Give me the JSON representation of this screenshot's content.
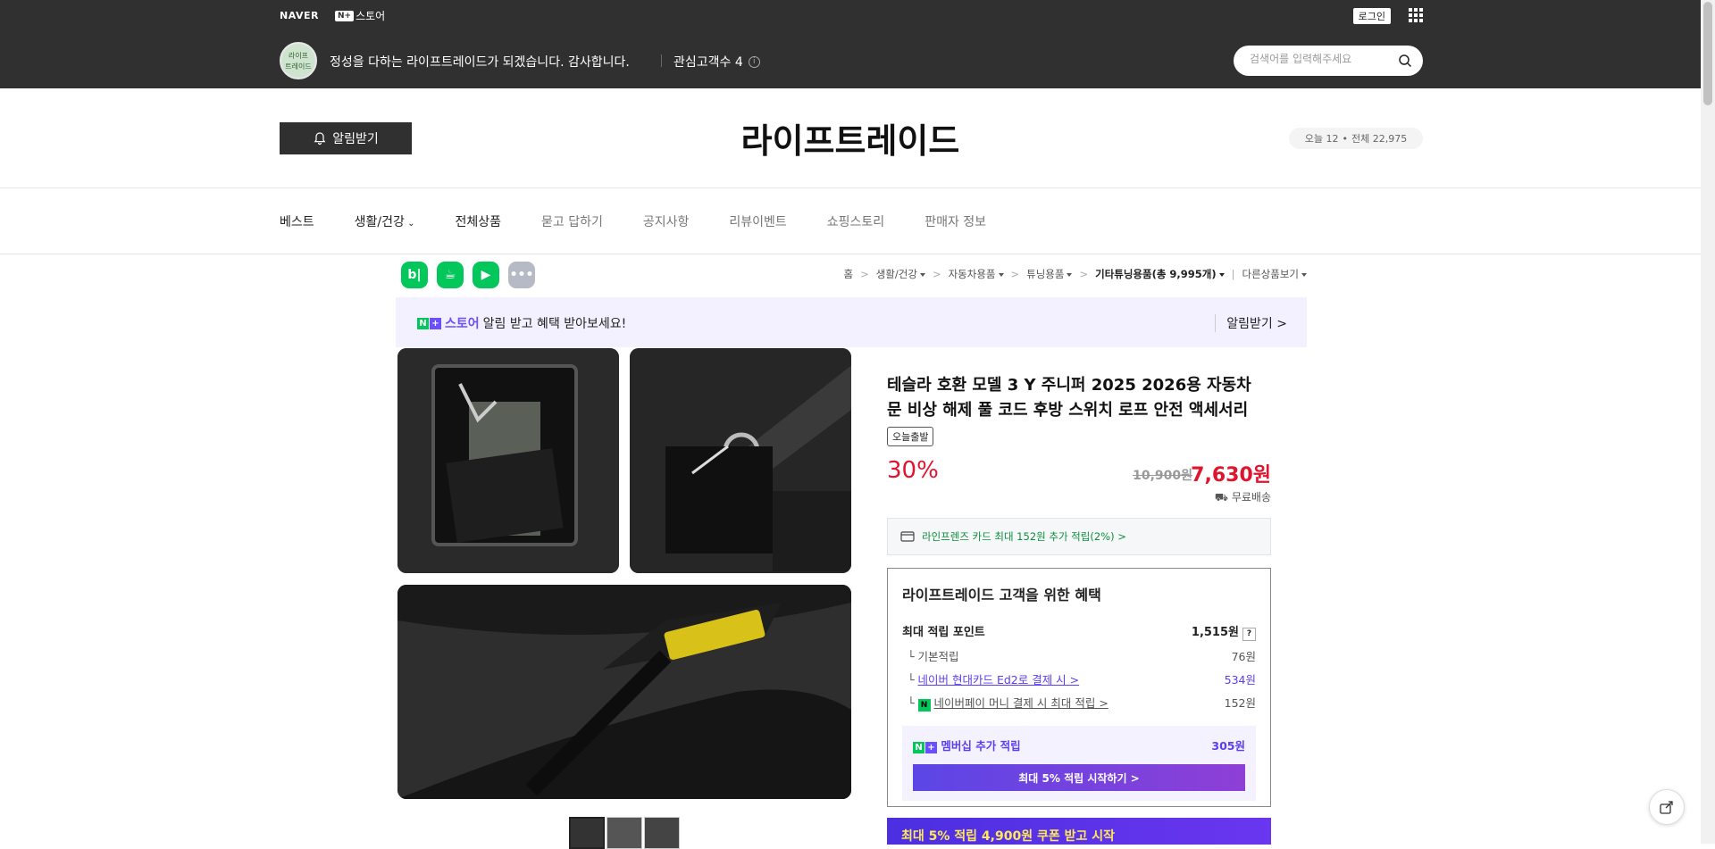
{
  "gnb": {
    "naver": "NAVER",
    "nplus": "N+",
    "store_suffix": "스토어",
    "login": "로그인"
  },
  "store": {
    "logo_text": "라이프\n트레이드",
    "description": "정성을 다하는 라이프트레이드가 되겠습니다. 감사합니다.",
    "fans_label": "관심고객수 4",
    "search_placeholder": "검색어를 입력해주세요"
  },
  "header": {
    "alarm_button": "알림받기",
    "title": "라이프트레이드",
    "visit_today": "오늘 12",
    "visit_dot": "•",
    "visit_total": "전체 22,975"
  },
  "nav": {
    "items": [
      "베스트",
      "생활/건강",
      "전체상품",
      "묻고 답하기",
      "공지사항",
      "리뷰이벤트",
      "쇼핑스토리",
      "판매자 정보"
    ]
  },
  "share": {
    "blog": "b|",
    "cafe": "☕",
    "band": "▶",
    "more": "•••"
  },
  "breadcrumb": {
    "home": "홈",
    "c1": "생활/건강",
    "c2": "자동차용품",
    "c3": "튜닝용품",
    "c4": "기타튜닝용품(총 9,995개)",
    "other": "다른상품보기"
  },
  "benefit_bar": {
    "store": "스토어",
    "text": "알림 받고 혜택 받아보세요!",
    "right": "알림받기 >"
  },
  "product": {
    "title": "테슬라 호환 모델 3 Y 주니퍼 2025 2026용 자동차 문 비상 해제 풀 코드 후방 스위치 로프 안전 액세서리",
    "tag": "오늘출발",
    "discount": "30%",
    "original_price": "10,900원",
    "price": "7,630원",
    "shipping": "무료배송",
    "card_benefit": "라인프렌즈 카드 최대 152원 추가 적립(2%) >"
  },
  "benefits": {
    "title": "라이프트레이드 고객을 위한 혜택",
    "max_label": "최대 적립 포인트",
    "max_value": "1,515원",
    "q": "?",
    "rows": [
      {
        "label": "기본적립",
        "value": "76원"
      },
      {
        "label": "네이버 현대카드 Ed2로 결제 시 >",
        "value": "534원"
      },
      {
        "label": "네이버페이 머니 결제 시 최대 적립 >",
        "value": "152원"
      }
    ],
    "membership_label": "멤버십 추가 적립",
    "membership_value": "305원",
    "membership_button": "최대 5% 적립 시작하기 >",
    "promo": "최대 5% 적립 4,900원 쿠폰 받고 시작"
  },
  "colors": {
    "topbar": "#303030",
    "accent_red": "#e0142e",
    "naver_green": "#03c75a",
    "purple": "#5b3ef0"
  }
}
